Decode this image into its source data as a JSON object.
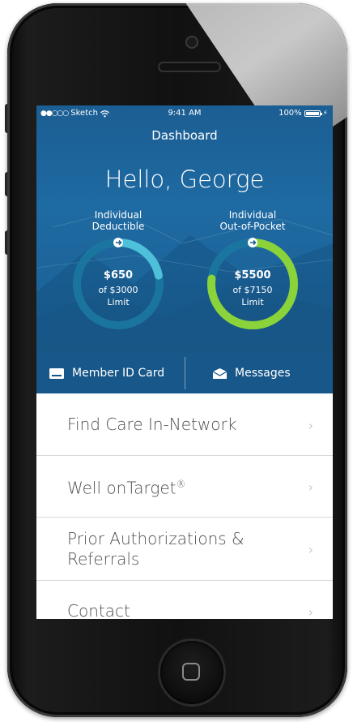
{
  "status_bar": {
    "carrier": "Sketch",
    "time": "9:41 AM",
    "battery": "100%"
  },
  "nav": {
    "title": "Dashboard"
  },
  "greeting": "Hello, George",
  "gauges": [
    {
      "label_line1": "Individual",
      "label_line2": "Deductible",
      "amount": "$650",
      "of_text": "of $3000",
      "limit_text": "Limit",
      "fraction": 0.2167,
      "color": "#4ec0d9"
    },
    {
      "label_line1": "Individual",
      "label_line2": "Out-of-Pocket",
      "amount": "$5500",
      "of_text": "of $7150",
      "limit_text": "Limit",
      "fraction": 0.7692,
      "color": "#8bd33a"
    }
  ],
  "actions": {
    "member_id": "Member ID Card",
    "messages": "Messages"
  },
  "menu": [
    {
      "label": "Find Care In-Network"
    },
    {
      "label": "Well onTarget",
      "sup": "®"
    },
    {
      "label": "Prior Authorizations & Referrals"
    },
    {
      "label": "Contact"
    }
  ],
  "colors": {
    "header": "#1e6aa2",
    "action_bar": "#17578a",
    "text": "#4f4f4f"
  }
}
